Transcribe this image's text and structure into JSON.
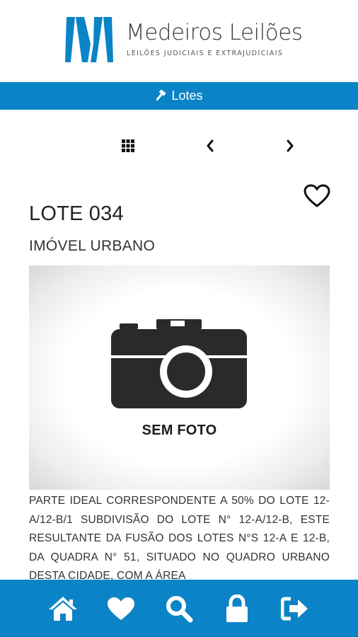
{
  "brand": {
    "name": "Medeiros Leilões",
    "tagline": "LEILÕES JUDICIAIS E EXTRAJUDICIAIS",
    "accent": "#0a84c6"
  },
  "topbar": {
    "icon": "gavel-icon",
    "title": "Lotes"
  },
  "pager": {
    "grid_icon": "grid-icon",
    "prev_icon": "chevron-left-icon",
    "next_icon": "chevron-right-icon"
  },
  "lot": {
    "title": "LOTE 034",
    "type": "IMÓVEL URBANO",
    "favorite_icon": "heart-outline-icon",
    "photo_placeholder": "SEM FOTO",
    "description": "PARTE IDEAL CORRESPONDENTE A 50% DO LOTE 12-A/12-B/1 SUBDIVISÃO DO LOTE N° 12-A/12-B, ESTE RESULTANTE DA FUSÃO DOS LOTES N°S 12-A E 12-B, DA QUADRA N° 51, SITUADO NO QUADRO URBANO DESTA CIDADE, COM A ÁREA"
  },
  "bottom_nav": [
    {
      "icon": "home-icon"
    },
    {
      "icon": "heart-icon"
    },
    {
      "icon": "search-icon"
    },
    {
      "icon": "lock-icon"
    },
    {
      "icon": "sign-out-icon"
    }
  ]
}
